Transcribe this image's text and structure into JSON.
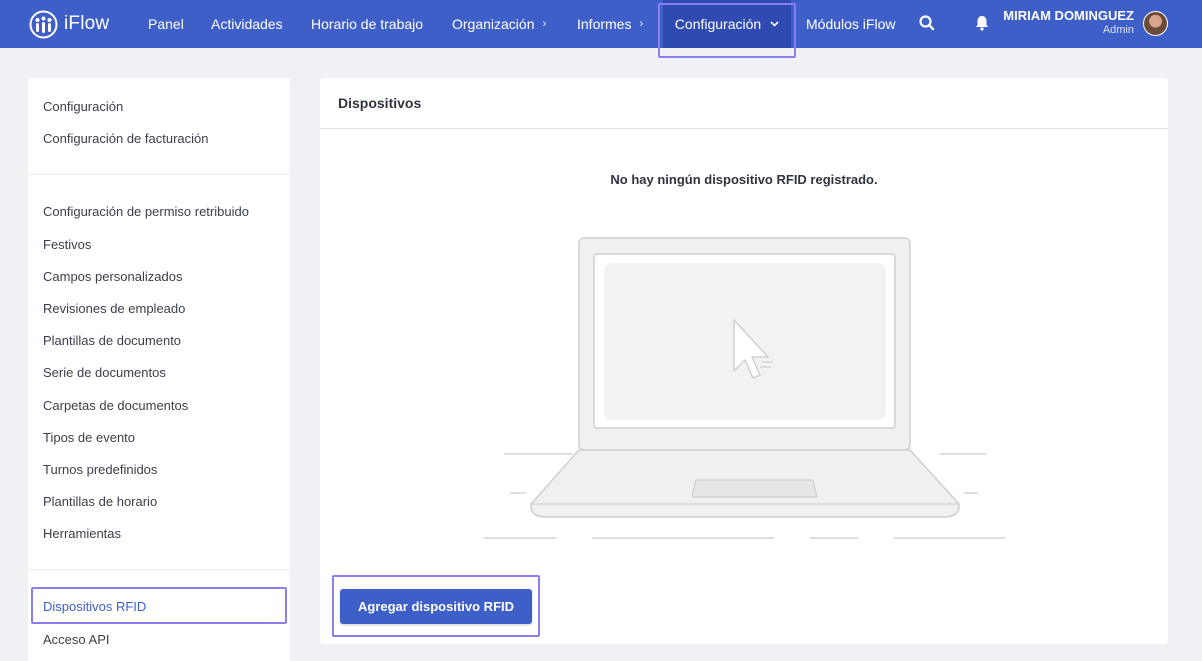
{
  "brand": {
    "name": "iFlow"
  },
  "nav": {
    "items": [
      {
        "label": "Panel"
      },
      {
        "label": "Actividades"
      },
      {
        "label": "Horario de trabajo"
      },
      {
        "label": "Organización"
      },
      {
        "label": "Informes"
      },
      {
        "label": "Configuración"
      },
      {
        "label": "Módulos iFlow"
      }
    ],
    "chevron_right": "›",
    "chevron_down": "⌄"
  },
  "user": {
    "name": "MIRIAM DOMINGUEZ",
    "role": "Admin"
  },
  "icons": {
    "search": "search-icon",
    "bell": "bell-icon",
    "logo": "people-logo-icon"
  },
  "sidebar": {
    "group1": [
      "Configuración",
      "Configuración de facturación"
    ],
    "group2": [
      "Configuración de permiso retribuido",
      "Festivos",
      "Campos personalizados",
      "Revisiones de empleado",
      "Plantillas de documento",
      "Serie de documentos",
      "Carpetas de documentos",
      "Tipos de evento",
      "Turnos predefinidos",
      "Plantillas de horario",
      "Herramientas"
    ],
    "group3": [
      "Dispositivos RFID",
      "Acceso API"
    ]
  },
  "main": {
    "title": "Dispositivos",
    "empty_message": "No hay ningún dispositivo RFID registrado.",
    "add_button": "Agregar dispositivo RFID"
  },
  "colors": {
    "primary": "#3e5fc8",
    "primary_dark": "#2f4bb1",
    "highlight": "#8a7ff0",
    "background": "#f0f1f4"
  }
}
